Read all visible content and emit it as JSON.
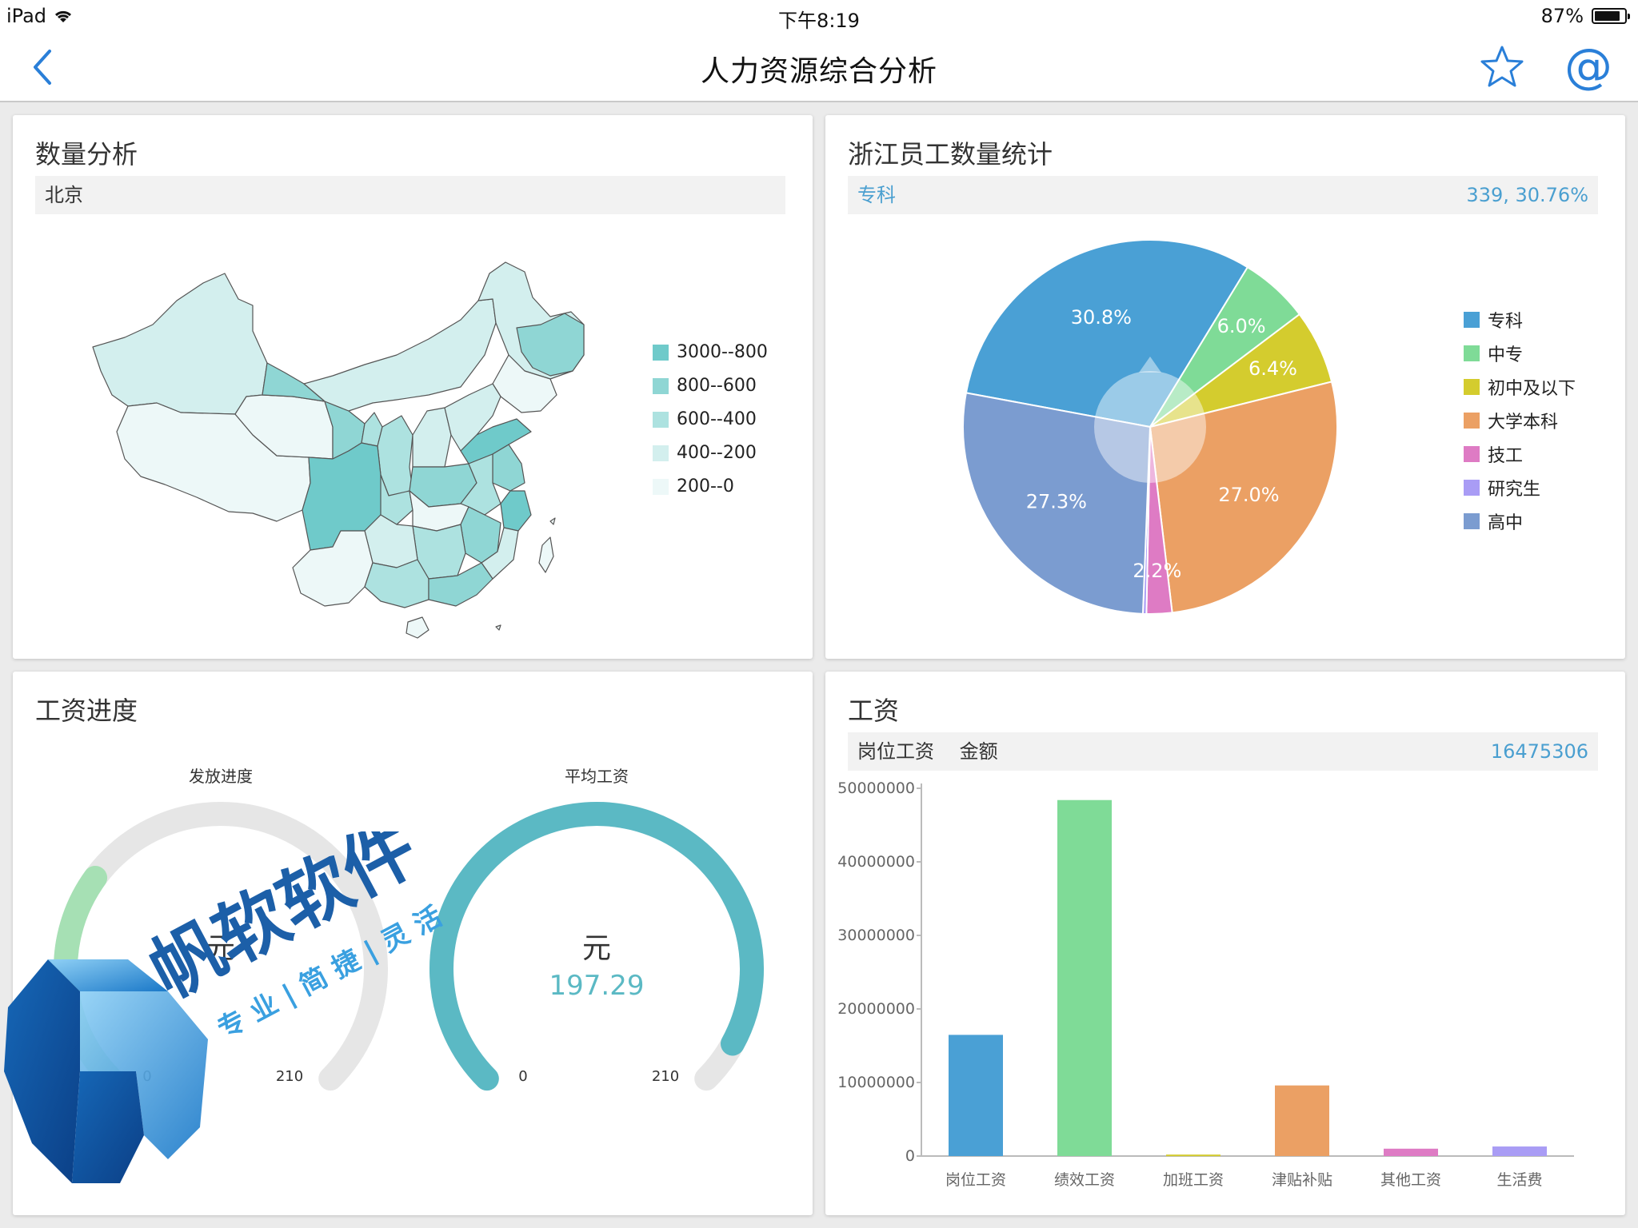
{
  "status": {
    "device": "iPad",
    "time": "下午8:19",
    "battery_text": "87%",
    "battery_level": 0.87
  },
  "nav": {
    "title": "人力资源综合分析",
    "back_icon": "chevron-left-icon",
    "star_icon": "star-icon",
    "at_label": "@",
    "accent": "#2a7fd8"
  },
  "map_panel": {
    "title": "数量分析",
    "selected": "北京",
    "legend": [
      {
        "label": "3000--800",
        "color": "#6fcaca"
      },
      {
        "label": "800--600",
        "color": "#8fd6d4"
      },
      {
        "label": "600--400",
        "color": "#ade2e0"
      },
      {
        "label": "400--200",
        "color": "#d3efee"
      },
      {
        "label": "200--0",
        "color": "#edf8f8"
      }
    ]
  },
  "pie_panel": {
    "title": "浙江员工数量统计",
    "selected_label": "专科",
    "selected_value": "339, 30.76%",
    "legend": [
      "专科",
      "中专",
      "初中及以下",
      "大学本科",
      "技工",
      "研究生",
      "高中"
    ]
  },
  "gauge_panel": {
    "title": "工资进度",
    "gauges": [
      {
        "title": "发放进度",
        "unit": "元",
        "value_text": "",
        "min_label": "0",
        "max_label": "210",
        "fraction": 0.3,
        "color": "#a6e0b4"
      },
      {
        "title": "平均工资",
        "unit": "元",
        "value_text": "197.29",
        "min_label": "0",
        "max_label": "210",
        "fraction": 0.94,
        "color": "#5bb9c4"
      }
    ]
  },
  "bar_panel": {
    "title": "工资",
    "header_left": "岗位工资",
    "header_mid": "金额",
    "header_value": "16475306"
  },
  "watermark": {
    "brand": "帆软软件",
    "tagline": "专 业 | 简 捷 | 灵 活"
  },
  "chart_data": [
    {
      "type": "pie",
      "title": "浙江员工数量统计",
      "categories": [
        "专科",
        "中专",
        "初中及以下",
        "大学本科",
        "技工",
        "研究生",
        "高中"
      ],
      "values": [
        30.8,
        6.0,
        6.4,
        27.0,
        2.2,
        0.3,
        27.3
      ],
      "value_labels": [
        "30.8%",
        "6.0%",
        "6.4%",
        "27.0%",
        "2.2%",
        "",
        "27.3%"
      ],
      "colors": [
        "#4aa0d5",
        "#7fdb97",
        "#d4cc2e",
        "#eba064",
        "#de7bc4",
        "#a99cf5",
        "#7b9cd0"
      ],
      "legend": "right"
    },
    {
      "type": "bar",
      "title": "工资",
      "categories": [
        "岗位工资",
        "绩效工资",
        "加班工资",
        "津贴补贴",
        "其他工资",
        "生活费"
      ],
      "values": [
        16475306,
        48400000,
        200000,
        9600000,
        1000000,
        1300000
      ],
      "colors": [
        "#4aa0d5",
        "#7fdb97",
        "#d4cc2e",
        "#eba064",
        "#de7bc4",
        "#a99cf5"
      ],
      "ylim": [
        0,
        50000000
      ],
      "yticks": [
        "0",
        "10000000",
        "20000000",
        "30000000",
        "40000000",
        "50000000"
      ]
    }
  ]
}
